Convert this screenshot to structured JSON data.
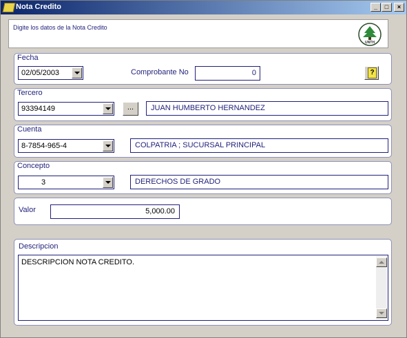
{
  "window": {
    "title": "Nota Credito",
    "icon": "folder-note-icon",
    "controls": [
      "minimize",
      "maximize",
      "close"
    ]
  },
  "header": {
    "instruction": "Digite los datos de la Nota Credito",
    "logo_text": "UNTH"
  },
  "fecha": {
    "label": "Fecha",
    "value": "02/05/2003",
    "comprobante_label": "Comprobante No",
    "comprobante_value": "0"
  },
  "tercero": {
    "label": "Tercero",
    "code": "93394149",
    "lookup_label": "...",
    "name": "JUAN HUMBERTO HERNANDEZ"
  },
  "cuenta": {
    "label": "Cuenta",
    "code": "8-7854-965-4",
    "description": "COLPATRIA  ;  SUCURSAL PRINCIPAL"
  },
  "concepto": {
    "label": "Concepto",
    "code": "3",
    "description": "DERECHOS DE GRADO"
  },
  "valor": {
    "label": "Valor",
    "value": "5,000.00"
  },
  "descripcion": {
    "label": "Descripcion",
    "value": "DESCRIPCION NOTA CREDITO."
  },
  "help_button_label": "?",
  "colors": {
    "title_bar": "#0a246a",
    "text": "#1f1f7a",
    "panel_border": "#8c8fb8",
    "background": "#d4d0c8"
  }
}
